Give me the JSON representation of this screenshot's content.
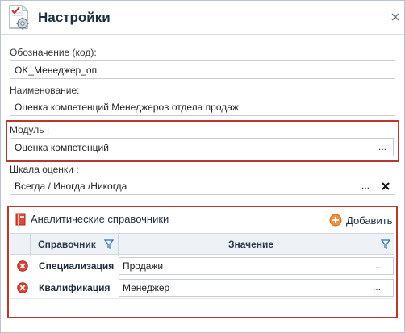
{
  "window": {
    "title": "Настройки"
  },
  "fields": {
    "code": {
      "label": "Обозначение (код):",
      "value": "OK_Менеджер_оп"
    },
    "name": {
      "label": "Наименование:",
      "value": "Оценка компетенций Менеджеров отдела продаж"
    },
    "module": {
      "label": "Модуль :",
      "value": "Оценка компетенций",
      "button": "..."
    },
    "scale": {
      "label": "Шкала оценки :",
      "value": "Всегда / Иногда /Никогда",
      "button": "..."
    }
  },
  "analytics": {
    "title": "Аналитические справочники",
    "add_label": "Добавить",
    "columns": {
      "ref": "Справочник",
      "value": "Значение"
    },
    "rows": [
      {
        "name": "Специализация",
        "value": "Продажи",
        "button": "..."
      },
      {
        "name": "Квалификация",
        "value": "Менеджер",
        "button": "..."
      }
    ]
  },
  "colors": {
    "highlight": "#b5392e",
    "delete": "#c9302c",
    "add": "#e8823a",
    "accent": "#2e6fb8"
  },
  "icons": {
    "app": "settings-document-icon",
    "close": "close-icon",
    "clear": "clear-x-icon",
    "book": "book-icon",
    "add": "add-circle-icon",
    "delete": "delete-circle-icon",
    "filter": "filter-icon"
  }
}
